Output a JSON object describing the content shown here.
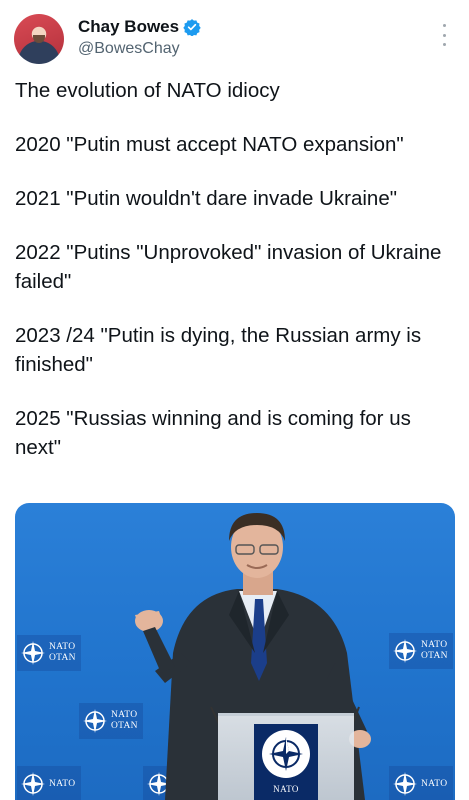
{
  "author": {
    "display_name": "Chay Bowes",
    "handle": "@BowesChay",
    "verified_color": "#1d9bf0"
  },
  "tweet": {
    "lines": [
      "The evolution of NATO idiocy",
      "2020 \"Putin must accept NATO expansion\"",
      "2021 \"Putin wouldn't dare invade Ukraine\"",
      "2022 \"Putins \"Unprovoked\" invasion of Ukraine failed\"",
      "2023 /24 \"Putin is dying, the Russian army is finished\"",
      "2025 \"Russias winning and is coming for us next\""
    ]
  },
  "media": {
    "backdrop_labels": {
      "nato": "NATO",
      "otan": "OTAN"
    },
    "accent_color": "#2073cc"
  },
  "icons": {
    "verified": "verified-badge-icon",
    "more": "more-options-icon"
  }
}
